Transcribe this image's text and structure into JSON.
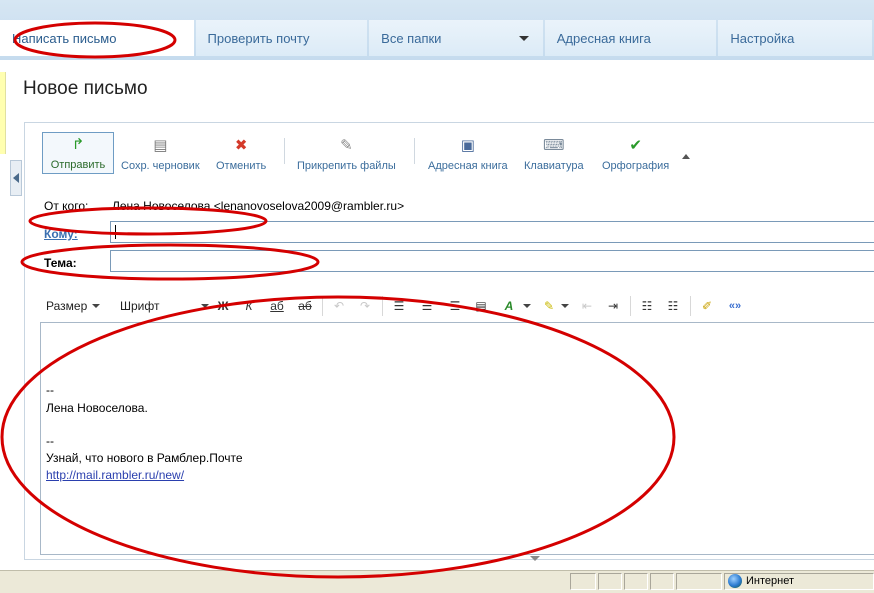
{
  "tabs": [
    {
      "label": "Написать письмо",
      "active": true
    },
    {
      "label": "Проверить почту"
    },
    {
      "label": "Все папки",
      "dropdown": true
    },
    {
      "label": "Адресная книга"
    },
    {
      "label": "Настройка"
    }
  ],
  "page_title": "Новое письмо",
  "toolbar": {
    "send": "Отправить",
    "draft": "Сохр. черновик",
    "cancel": "Отменить",
    "attach": "Прикрепить файлы",
    "address_book": "Адресная книга",
    "keyboard": "Клавиатура",
    "spelling": "Орфография"
  },
  "fields": {
    "from_label": "От кого:",
    "from_value": "Лена Новоселова <lenanovoselova2009@rambler.ru>",
    "to_label": "Кому:",
    "to_value": "",
    "subject_label": "Тема:",
    "subject_value": ""
  },
  "format": {
    "size": "Размер",
    "font": "Шрифт",
    "bold": "Ж",
    "italic": "К",
    "underline": "аб",
    "strike": "аб",
    "link_icon": "«»"
  },
  "signature": {
    "dash1": "--",
    "name": "Лена Новоселова.",
    "dash2": "--",
    "promo": "Узнай, что нового в Рамблер.Почте",
    "link": "http://mail.rambler.ru/new/"
  },
  "status": {
    "zone": "Интернет"
  },
  "colors": {
    "highlight": "#d40000",
    "accent": "#3a6a9a"
  }
}
